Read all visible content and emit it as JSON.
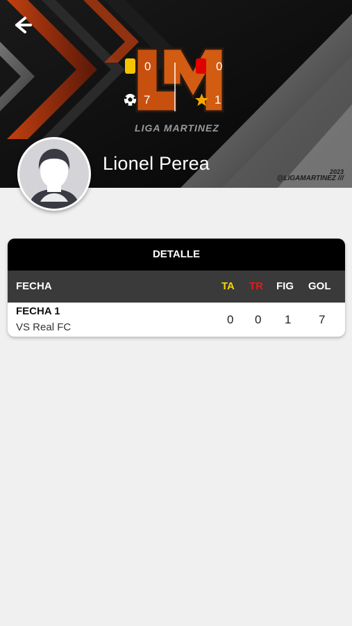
{
  "header": {
    "back_icon": "arrow-left-icon",
    "stats": {
      "yellow_cards": "0",
      "red_cards": "0",
      "goals": "7",
      "mvp": "1"
    },
    "logo_text": "LIGA MARTINEZ",
    "hashtag_year": "2023",
    "hashtag": "@LIGAMARTINEZ ///"
  },
  "player": {
    "name": "Lionel Perea",
    "avatar_icon": "default-avatar-icon"
  },
  "detail": {
    "title": "DETALLE",
    "columns": {
      "date": "FECHA",
      "yellow": "TA",
      "red": "TR",
      "mvp": "FIG",
      "goals": "GOL"
    },
    "rows": [
      {
        "fecha": "FECHA 1",
        "opponent": "VS Real FC",
        "ta": "0",
        "tr": "0",
        "fig": "1",
        "gol": "7"
      }
    ]
  },
  "colors": {
    "yellow": "#f5c400",
    "red": "#e00000",
    "accent_orange": "#c84a10"
  }
}
